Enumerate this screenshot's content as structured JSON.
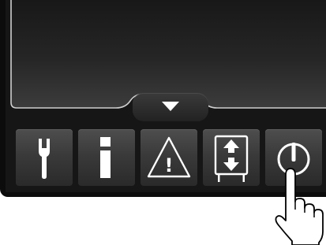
{
  "panel": {
    "display_text": "",
    "drawer_handle_icon": "chevron-down-icon",
    "colors": {
      "bezel": "#0c0c0c",
      "display_top": "#1c1c1c",
      "display_bottom": "#3a3a3a",
      "outline": "#cfcfcf",
      "button": "#3a3a3a",
      "glyph": "#ffffff"
    }
  },
  "toolbar": {
    "buttons": [
      {
        "id": "service",
        "icon": "wrench-icon",
        "label": ""
      },
      {
        "id": "info",
        "icon": "info-icon",
        "label": "i"
      },
      {
        "id": "warning",
        "icon": "warning-icon",
        "label": "!"
      },
      {
        "id": "input-select",
        "icon": "input-select-icon",
        "label": ""
      },
      {
        "id": "power",
        "icon": "power-icon",
        "label": ""
      }
    ]
  },
  "pointer": {
    "icon": "pointing-hand-icon"
  }
}
